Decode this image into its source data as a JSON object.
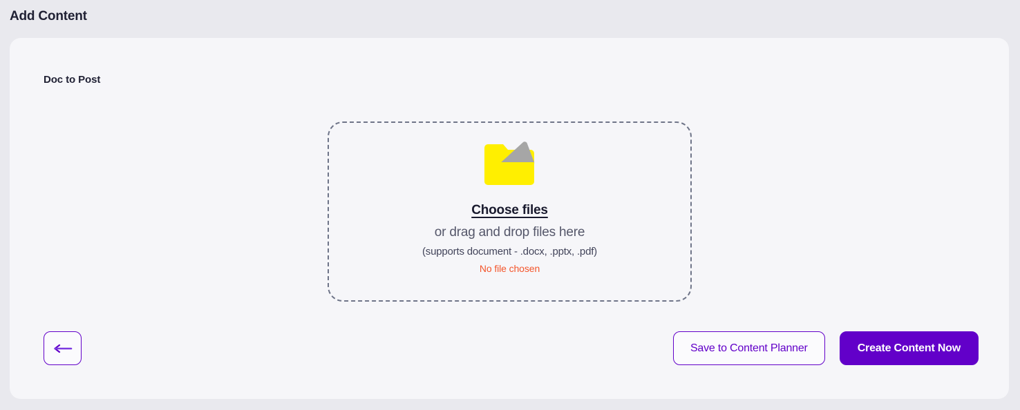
{
  "header": {
    "title": "Add Content"
  },
  "card": {
    "section_label": "Doc to Post"
  },
  "dropzone": {
    "icon_name": "folder-with-document-icon",
    "choose_files_label": "Choose files",
    "drag_drop_text": "or drag and drop files here",
    "supports_text": "(supports document - .docx, .pptx, .pdf)",
    "file_status": "No file chosen"
  },
  "footer": {
    "back_icon": "arrow-left-icon",
    "save_label": "Save to Content Planner",
    "create_label": "Create Content Now"
  },
  "colors": {
    "accent_purple": "#6200c9",
    "page_background": "#e9e9ee",
    "card_background": "#f6f6f9",
    "status_orange": "#f4552b",
    "folder_yellow": "#ffef00",
    "document_gray": "#a6a6a6",
    "dashed_border": "#6e7488",
    "heading_text": "#1f2033"
  }
}
